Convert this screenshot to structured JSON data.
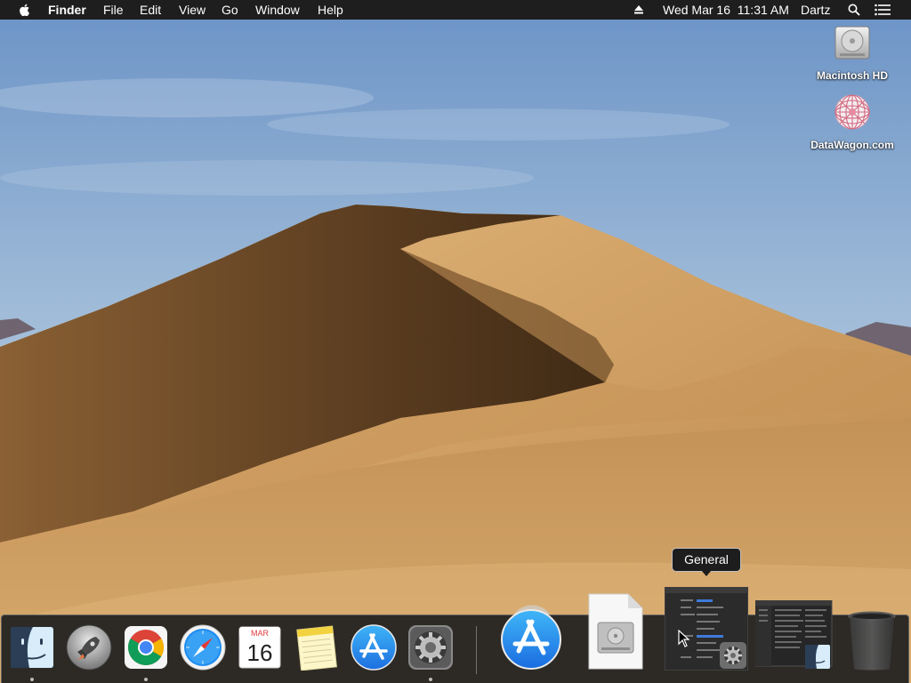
{
  "menubar": {
    "app_name": "Finder",
    "menus": [
      "File",
      "Edit",
      "View",
      "Go",
      "Window",
      "Help"
    ],
    "clock": "Wed Mar 16  11:31 AM",
    "user": "Dartz",
    "icons": [
      "apple-icon",
      "eject-icon",
      "spotlight-icon",
      "notification-list-icon"
    ]
  },
  "desktop": {
    "icons": [
      {
        "label": "Macintosh HD",
        "icon": "hard-drive-icon"
      },
      {
        "label": "DataWagon.com",
        "icon": "network-globe-icon"
      }
    ]
  },
  "tooltip": {
    "text": "General"
  },
  "calendar": {
    "month": "MAR",
    "day": "16"
  },
  "dock": {
    "items": [
      {
        "name": "Finder",
        "icon": "finder-icon",
        "running": true
      },
      {
        "name": "Launchpad",
        "icon": "launchpad-icon",
        "running": false
      },
      {
        "name": "Google Chrome",
        "icon": "chrome-icon",
        "running": true
      },
      {
        "name": "Safari",
        "icon": "safari-icon",
        "running": false
      },
      {
        "name": "Calendar",
        "icon": "calendar-icon",
        "running": false
      },
      {
        "name": "Notes",
        "icon": "notes-icon",
        "running": false
      },
      {
        "name": "App Store",
        "icon": "app-store-icon",
        "running": false
      },
      {
        "name": "System Preferences",
        "icon": "system-preferences-icon",
        "running": true
      },
      {
        "name": "App Store download",
        "icon": "app-store-large-icon",
        "running": false
      },
      {
        "name": "Disk image",
        "icon": "disk-image-file-icon",
        "running": false
      },
      {
        "name": "General",
        "icon": "window-thumbnail-system-preferences",
        "running": false
      },
      {
        "name": "Finder window",
        "icon": "window-thumbnail-finder",
        "running": false
      },
      {
        "name": "Trash",
        "icon": "trash-icon",
        "running": false
      }
    ]
  },
  "colors": {
    "menubar_bg": "#1e1e1e",
    "dock_bg": "#1e1e1e",
    "sky_top": "#6f98c9",
    "sand": "#c99a5e"
  }
}
